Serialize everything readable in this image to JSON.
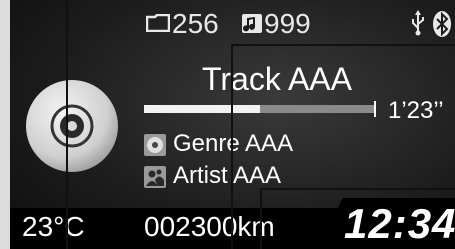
{
  "topbar": {
    "folder_icon": "folder-icon",
    "folder_count": "256",
    "track_icon": "music-note-icon",
    "track_count": "999",
    "usb_icon": "usb-icon",
    "bluetooth_icon": "bluetooth-icon"
  },
  "media": {
    "disc_icon": "disc-icon",
    "track_title": "Track AAA",
    "elapsed": "1’23’’",
    "progress": 0.5,
    "genre_icon": "genre-icon",
    "genre": "Genre AAA",
    "artist_icon": "artist-icon",
    "artist": "Artist AAA"
  },
  "status": {
    "temperature": "23°C",
    "odometer": "002300km",
    "clock": "12:34"
  },
  "colors": {
    "screen_bg": "#1c1c1c",
    "text": "#ffffff",
    "progress_track": "#8a8a8a",
    "progress_fill": "#f2f2f2",
    "page_bg": "#dcdcdc"
  }
}
